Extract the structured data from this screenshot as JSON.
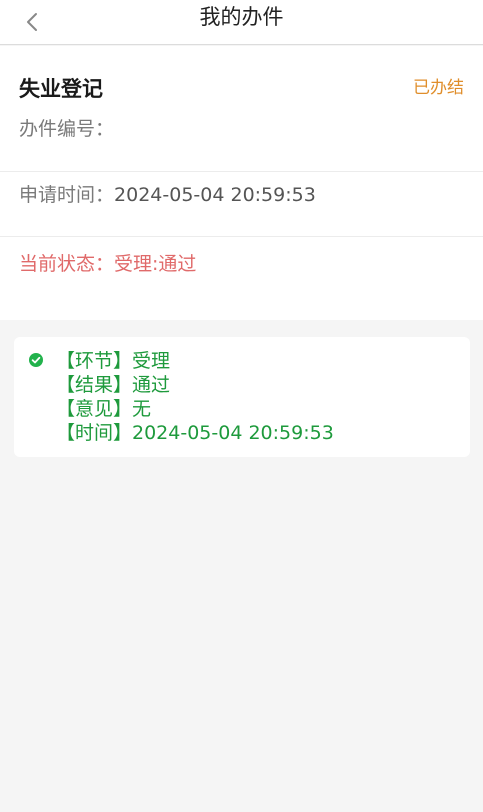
{
  "navbar": {
    "title": "我的办件",
    "back_icon": "chevron-left-icon"
  },
  "case": {
    "title": "失业登记",
    "status": "已办结",
    "number_label": "办件编号：",
    "number_value": "",
    "apply_time_label": "申请时间：",
    "apply_time_value": "2024-05-04 20:59:53",
    "current_state_label": "当前状态：",
    "current_state_value": "受理:通过"
  },
  "timeline": [
    {
      "icon": "check-circle-icon",
      "lines": [
        "【环节】受理",
        "【结果】通过",
        "【意见】无",
        "【时间】2024-05-04 20:59:53"
      ]
    }
  ],
  "colors": {
    "background": "#f5f5f5",
    "status_done": "#e08e2b",
    "current_state": "#e06a6a",
    "timeline_green": "#1e9a3c",
    "check_green": "#22b24c"
  }
}
